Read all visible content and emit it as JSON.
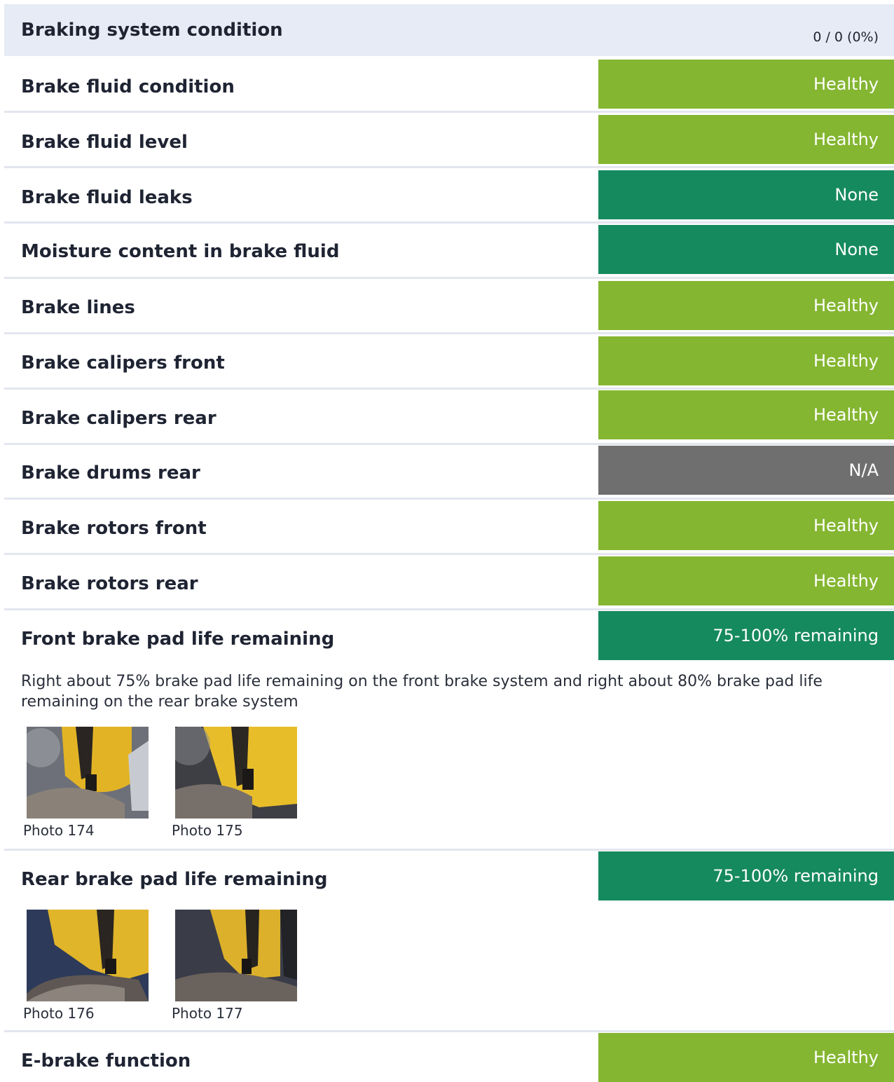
{
  "section": {
    "title": "Braking system condition",
    "score": "0 / 0 (0%)"
  },
  "colors": {
    "healthy": "#84b631",
    "none": "#168a5f",
    "na": "#6f6f6f",
    "remaining": "#168a5f"
  },
  "items": [
    {
      "label": "Brake fluid condition",
      "status": "Healthy"
    },
    {
      "label": "Brake fluid level",
      "status": "Healthy"
    },
    {
      "label": "Brake fluid leaks",
      "status": "None"
    },
    {
      "label": "Moisture content in brake fluid",
      "status": "None"
    },
    {
      "label": "Brake lines",
      "status": "Healthy"
    },
    {
      "label": "Brake calipers front",
      "status": "Healthy"
    },
    {
      "label": "Brake calipers rear",
      "status": "Healthy"
    },
    {
      "label": "Brake drums rear",
      "status": "N/A"
    },
    {
      "label": "Brake rotors front",
      "status": "Healthy"
    },
    {
      "label": "Brake rotors rear",
      "status": "Healthy"
    },
    {
      "label": "Front brake pad life remaining",
      "status": "75-100% remaining",
      "note": "Right about 75% brake pad life remaining on the front brake system and right about 80% brake pad life remaining on the rear brake system",
      "photos": [
        {
          "caption": "Photo 174",
          "icon": "brake-caliper-photo"
        },
        {
          "caption": "Photo 175",
          "icon": "brake-caliper-photo"
        }
      ]
    },
    {
      "label": "Rear brake pad life remaining",
      "status": "75-100% remaining",
      "photos": [
        {
          "caption": "Photo 176",
          "icon": "brake-caliper-photo"
        },
        {
          "caption": "Photo 177",
          "icon": "brake-caliper-photo"
        }
      ]
    },
    {
      "label": "E-brake function",
      "status": "Healthy"
    }
  ]
}
